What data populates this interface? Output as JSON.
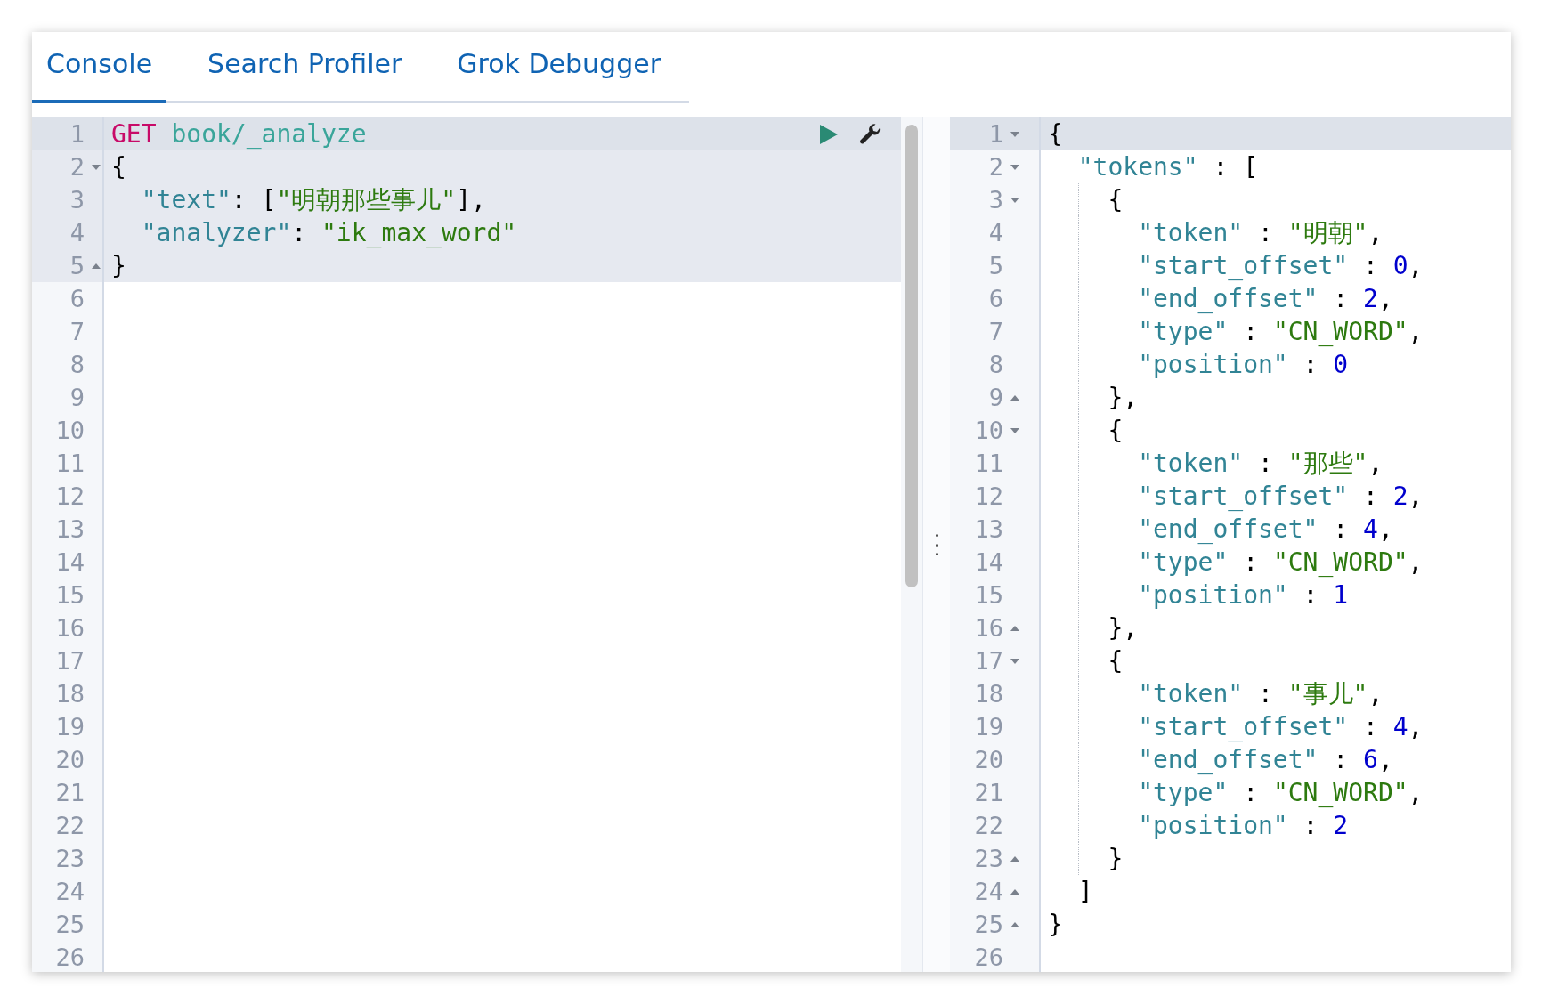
{
  "tabs": [
    {
      "label": "Console",
      "selected": true
    },
    {
      "label": "Search Profiler",
      "selected": false
    },
    {
      "label": "Grok Debugger",
      "selected": false
    }
  ],
  "request_editor": {
    "lines": [
      {
        "number": "1",
        "active": true,
        "highlighted": true,
        "tokens": [
          {
            "kind": "method",
            "text": "GET "
          },
          {
            "kind": "url",
            "text": "book/_analyze"
          }
        ]
      },
      {
        "number": "2",
        "highlighted": true,
        "fold_start": true,
        "tokens": [
          {
            "kind": "punct",
            "text": "{"
          }
        ]
      },
      {
        "number": "3",
        "highlighted": true,
        "tokens": [
          {
            "kind": "key",
            "text": "  \"text\""
          },
          {
            "kind": "punct",
            "text": ": ["
          },
          {
            "kind": "string",
            "text": "\"明朝那些事儿\""
          },
          {
            "kind": "punct",
            "text": "],"
          }
        ]
      },
      {
        "number": "4",
        "highlighted": true,
        "tokens": [
          {
            "kind": "key",
            "text": "  \"analyzer\""
          },
          {
            "kind": "punct",
            "text": ": "
          },
          {
            "kind": "string",
            "text": "\"ik_max_word\""
          }
        ]
      },
      {
        "number": "5",
        "highlighted": true,
        "fold_end": true,
        "tokens": [
          {
            "kind": "punct",
            "text": "}"
          }
        ]
      },
      {
        "number": "6"
      },
      {
        "number": "7"
      },
      {
        "number": "8"
      },
      {
        "number": "9"
      },
      {
        "number": "10"
      },
      {
        "number": "11"
      },
      {
        "number": "12"
      },
      {
        "number": "13"
      },
      {
        "number": "14"
      },
      {
        "number": "15"
      },
      {
        "number": "16"
      },
      {
        "number": "17"
      },
      {
        "number": "18"
      },
      {
        "number": "19"
      },
      {
        "number": "20"
      },
      {
        "number": "21"
      },
      {
        "number": "22"
      },
      {
        "number": "23"
      },
      {
        "number": "24"
      },
      {
        "number": "25"
      },
      {
        "number": "26"
      }
    ]
  },
  "response_editor": {
    "lines": [
      {
        "number": "1",
        "active": true,
        "fold_start": true,
        "tokens": [
          {
            "kind": "punct",
            "text": "{"
          }
        ]
      },
      {
        "number": "2",
        "fold_start": true,
        "tokens": [
          {
            "kind": "key",
            "text": "  \"tokens\""
          },
          {
            "kind": "punct",
            "text": " : ["
          }
        ]
      },
      {
        "number": "3",
        "fold_start": true,
        "tokens": [
          {
            "kind": "punct",
            "text": "    {"
          }
        ]
      },
      {
        "number": "4",
        "tokens": [
          {
            "kind": "key",
            "text": "      \"token\""
          },
          {
            "kind": "punct",
            "text": " : "
          },
          {
            "kind": "string",
            "text": "\"明朝\""
          },
          {
            "kind": "punct",
            "text": ","
          }
        ]
      },
      {
        "number": "5",
        "tokens": [
          {
            "kind": "key",
            "text": "      \"start_offset\""
          },
          {
            "kind": "punct",
            "text": " : "
          },
          {
            "kind": "number",
            "text": "0"
          },
          {
            "kind": "punct",
            "text": ","
          }
        ]
      },
      {
        "number": "6",
        "tokens": [
          {
            "kind": "key",
            "text": "      \"end_offset\""
          },
          {
            "kind": "punct",
            "text": " : "
          },
          {
            "kind": "number",
            "text": "2"
          },
          {
            "kind": "punct",
            "text": ","
          }
        ]
      },
      {
        "number": "7",
        "tokens": [
          {
            "kind": "key",
            "text": "      \"type\""
          },
          {
            "kind": "punct",
            "text": " : "
          },
          {
            "kind": "string",
            "text": "\"CN_WORD\""
          },
          {
            "kind": "punct",
            "text": ","
          }
        ]
      },
      {
        "number": "8",
        "tokens": [
          {
            "kind": "key",
            "text": "      \"position\""
          },
          {
            "kind": "punct",
            "text": " : "
          },
          {
            "kind": "number",
            "text": "0"
          }
        ]
      },
      {
        "number": "9",
        "fold_end": true,
        "tokens": [
          {
            "kind": "punct",
            "text": "    },"
          }
        ]
      },
      {
        "number": "10",
        "fold_start": true,
        "tokens": [
          {
            "kind": "punct",
            "text": "    {"
          }
        ]
      },
      {
        "number": "11",
        "tokens": [
          {
            "kind": "key",
            "text": "      \"token\""
          },
          {
            "kind": "punct",
            "text": " : "
          },
          {
            "kind": "string",
            "text": "\"那些\""
          },
          {
            "kind": "punct",
            "text": ","
          }
        ]
      },
      {
        "number": "12",
        "tokens": [
          {
            "kind": "key",
            "text": "      \"start_offset\""
          },
          {
            "kind": "punct",
            "text": " : "
          },
          {
            "kind": "number",
            "text": "2"
          },
          {
            "kind": "punct",
            "text": ","
          }
        ]
      },
      {
        "number": "13",
        "tokens": [
          {
            "kind": "key",
            "text": "      \"end_offset\""
          },
          {
            "kind": "punct",
            "text": " : "
          },
          {
            "kind": "number",
            "text": "4"
          },
          {
            "kind": "punct",
            "text": ","
          }
        ]
      },
      {
        "number": "14",
        "tokens": [
          {
            "kind": "key",
            "text": "      \"type\""
          },
          {
            "kind": "punct",
            "text": " : "
          },
          {
            "kind": "string",
            "text": "\"CN_WORD\""
          },
          {
            "kind": "punct",
            "text": ","
          }
        ]
      },
      {
        "number": "15",
        "tokens": [
          {
            "kind": "key",
            "text": "      \"position\""
          },
          {
            "kind": "punct",
            "text": " : "
          },
          {
            "kind": "number",
            "text": "1"
          }
        ]
      },
      {
        "number": "16",
        "fold_end": true,
        "tokens": [
          {
            "kind": "punct",
            "text": "    },"
          }
        ]
      },
      {
        "number": "17",
        "fold_start": true,
        "tokens": [
          {
            "kind": "punct",
            "text": "    {"
          }
        ]
      },
      {
        "number": "18",
        "tokens": [
          {
            "kind": "key",
            "text": "      \"token\""
          },
          {
            "kind": "punct",
            "text": " : "
          },
          {
            "kind": "string",
            "text": "\"事儿\""
          },
          {
            "kind": "punct",
            "text": ","
          }
        ]
      },
      {
        "number": "19",
        "tokens": [
          {
            "kind": "key",
            "text": "      \"start_offset\""
          },
          {
            "kind": "punct",
            "text": " : "
          },
          {
            "kind": "number",
            "text": "4"
          },
          {
            "kind": "punct",
            "text": ","
          }
        ]
      },
      {
        "number": "20",
        "tokens": [
          {
            "kind": "key",
            "text": "      \"end_offset\""
          },
          {
            "kind": "punct",
            "text": " : "
          },
          {
            "kind": "number",
            "text": "6"
          },
          {
            "kind": "punct",
            "text": ","
          }
        ]
      },
      {
        "number": "21",
        "tokens": [
          {
            "kind": "key",
            "text": "      \"type\""
          },
          {
            "kind": "punct",
            "text": " : "
          },
          {
            "kind": "string",
            "text": "\"CN_WORD\""
          },
          {
            "kind": "punct",
            "text": ","
          }
        ]
      },
      {
        "number": "22",
        "tokens": [
          {
            "kind": "key",
            "text": "      \"position\""
          },
          {
            "kind": "punct",
            "text": " : "
          },
          {
            "kind": "number",
            "text": "2"
          }
        ]
      },
      {
        "number": "23",
        "fold_end": true,
        "tokens": [
          {
            "kind": "punct",
            "text": "    }"
          }
        ]
      },
      {
        "number": "24",
        "fold_end": true,
        "tokens": [
          {
            "kind": "punct",
            "text": "  ]"
          }
        ]
      },
      {
        "number": "25",
        "fold_end": true,
        "tokens": [
          {
            "kind": "punct",
            "text": "}"
          }
        ]
      },
      {
        "number": "26"
      }
    ]
  }
}
